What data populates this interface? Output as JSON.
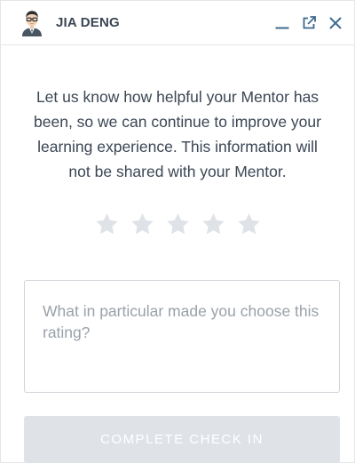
{
  "header": {
    "name": "JIA DENG",
    "avatar_icon": "mentor-avatar-icon",
    "minimize_icon": "minimize-icon",
    "popout_icon": "external-link-icon",
    "close_icon": "close-icon"
  },
  "rating": {
    "message": "Let us know how helpful your Mentor has been, so we can continue to improve your learning experience. This information will not be shared with your Mentor.",
    "stars_total": 5,
    "stars_selected": 0,
    "star_color": "#dfe3e8"
  },
  "feedback": {
    "placeholder": "What in particular made you choose this rating?",
    "value": ""
  },
  "submit": {
    "label": "COMPLETE CHECK IN",
    "disabled": true
  },
  "colors": {
    "text": "#3b4654",
    "accent_blue": "#3d6a90",
    "border": "#e3e6ea",
    "button_disabled": "#dfe3e8"
  }
}
